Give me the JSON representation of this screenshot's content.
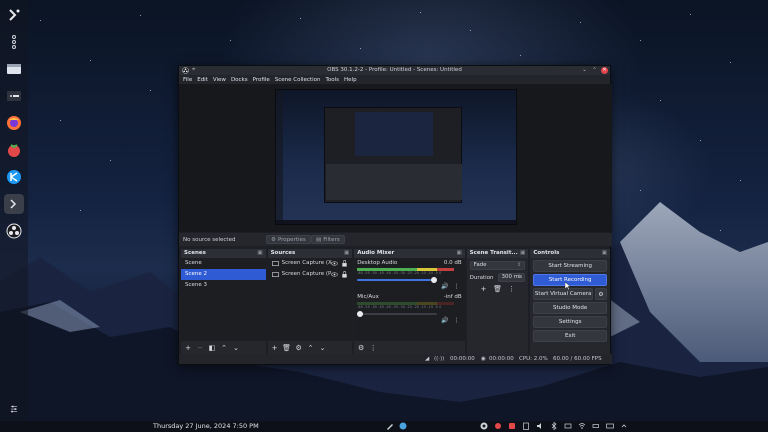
{
  "taskbar": {
    "datetime": "Thursday 27 June, 2024 7:50 PM"
  },
  "dock": {
    "items": [
      "kde-launcher-icon",
      "overview-icon",
      "window-list-icon",
      "firefox-icon",
      "raspberry-icon",
      "kde-connect-icon",
      "terminal-icon",
      "obs-icon"
    ]
  },
  "obs": {
    "title": "OBS 30.1.2-2 - Profile: Untitled - Scenes: Untitled",
    "menu": [
      "File",
      "Edit",
      "View",
      "Docks",
      "Profile",
      "Scene Collection",
      "Tools",
      "Help"
    ],
    "source_toolbar": {
      "no_source": "No source selected",
      "properties": "Properties",
      "filters": "Filters"
    },
    "docks": {
      "scenes": {
        "title": "Scenes",
        "items": [
          "Scene",
          "Scene 2",
          "Scene 3"
        ],
        "selected": "Scene 2"
      },
      "sources": {
        "title": "Sources",
        "items": [
          "Screen Capture (X",
          "Screen Capture (P"
        ]
      },
      "mixer": {
        "title": "Audio Mixer",
        "channels": [
          {
            "name": "Desktop Audio",
            "db": "0.0 dB",
            "level": 0.92
          },
          {
            "name": "Mic/Aux",
            "db": "-inf dB",
            "level": 0.0
          }
        ],
        "ticks": "-60 -55 -50 -45 -40 -35 -30 -25 -20 -15 -10 -5 0"
      },
      "transitions": {
        "title": "Scene Transit...",
        "transition": "Fade",
        "duration_label": "Duration",
        "duration": "300 ms"
      },
      "controls": {
        "title": "Controls",
        "start_streaming": "Start Streaming",
        "start_recording": "Start Recording",
        "start_virtual_camera": "Start Virtual Camera",
        "studio_mode": "Studio Mode",
        "settings": "Settings",
        "exit": "Exit"
      }
    },
    "status": {
      "stream_time": "00:00:00",
      "record_time": "00:00:00",
      "cpu": "CPU: 2.0%",
      "fps": "60.00 / 60.00 FPS"
    }
  },
  "colors": {
    "accent": "#2f5bd4",
    "window_bg": "#1e1f24",
    "dock_header": "#2d2f36",
    "close": "#e0454b"
  }
}
